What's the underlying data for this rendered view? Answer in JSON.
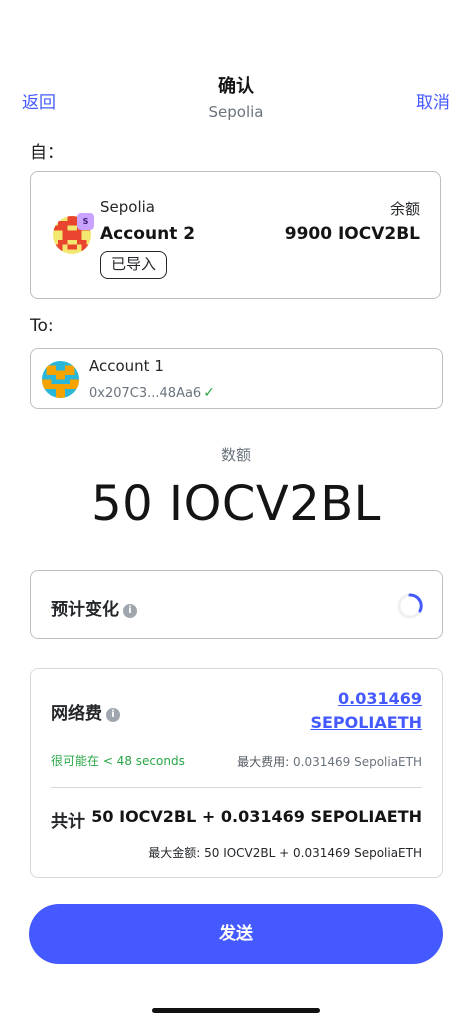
{
  "header": {
    "back_label": "返回",
    "title": "确认",
    "network": "Sepolia",
    "cancel_label": "取消"
  },
  "from": {
    "label": "自：",
    "network": "Sepolia",
    "network_badge": "S",
    "account_name": "Account 2",
    "tag": "已导入",
    "balance_label": "余额",
    "balance_value": "9900 IOCV2BL"
  },
  "to": {
    "label": "To:",
    "account_name": "Account 1",
    "address": "0x207C3...48Aa6"
  },
  "amount": {
    "label": "数额",
    "value": "50 IOCV2BL"
  },
  "estimated_changes": {
    "label": "预计变化",
    "icon": "info-icon",
    "status_icon": "loading-spinner"
  },
  "fee": {
    "label": "网络费",
    "amount_line1": "0.031469",
    "amount_line2": "SEPOLIAETH",
    "time_estimate": "很可能在 < 48 seconds",
    "max_fee_label": "最大费用:",
    "max_fee_value": "0.031469 SepoliaETH"
  },
  "total": {
    "label": "共计",
    "value": "50 IOCV2BL + 0.031469 SEPOLIAETH",
    "max_label": "最大金额:",
    "max_value": "50 IOCV2BL + 0.031469 SepoliaETH"
  },
  "actions": {
    "send_label": "发送"
  },
  "colors": {
    "accent": "#4459ff",
    "success": "#28a745",
    "border": "#bbc0c5",
    "muted_text": "#6a737d"
  }
}
